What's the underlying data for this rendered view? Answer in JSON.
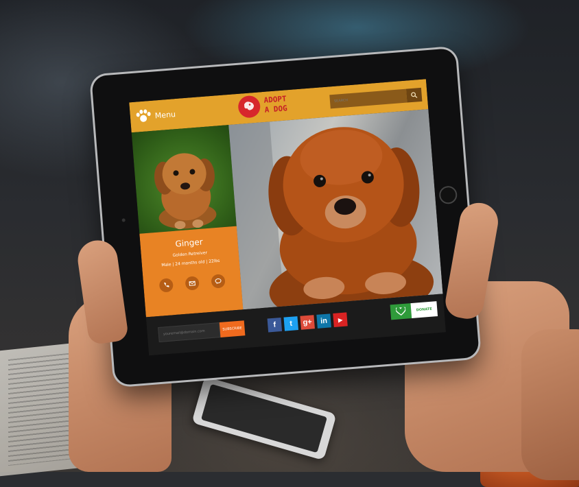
{
  "header": {
    "menu_label": "Menu",
    "logo_line1": "ADOPT",
    "logo_line2": "A DOG",
    "search_placeholder": "SEARCH"
  },
  "profile": {
    "name": "Ginger",
    "breed": "Golden Retreiver",
    "stats": "Male  |  24 months old  |  22lbs",
    "actions": [
      "phone-icon",
      "mail-icon",
      "chat-icon"
    ]
  },
  "footer": {
    "email_placeholder": "youremail@domain.com",
    "subscribe_label": "SUBSCRIBE",
    "social": [
      {
        "name": "facebook",
        "glyph": "f",
        "color": "#3b5998"
      },
      {
        "name": "twitter",
        "glyph": "t",
        "color": "#1da1f2"
      },
      {
        "name": "google-plus",
        "glyph": "g+",
        "color": "#dd4b39"
      },
      {
        "name": "linkedin",
        "glyph": "in",
        "color": "#0e76a8"
      },
      {
        "name": "youtube",
        "glyph": "▶",
        "color": "#d92323"
      }
    ],
    "donate_label": "DONATE"
  },
  "colors": {
    "header": "#e3a22b",
    "profile_card": "#e88324",
    "subscribe": "#ef6a1e",
    "donate": "#2f9b3a",
    "logo": "#c52026"
  }
}
